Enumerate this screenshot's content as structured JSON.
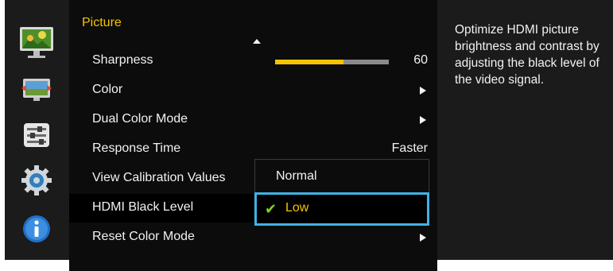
{
  "sidebar": {
    "icons": [
      "picture-monitor-icon",
      "screen-adjust-icon",
      "settings-sliders-icon",
      "gear-icon",
      "info-icon"
    ]
  },
  "menu": {
    "title": "Picture",
    "items": [
      {
        "label": "Sharpness",
        "value": "60",
        "slider_level": 0.6
      },
      {
        "label": "Color",
        "has_submenu": true
      },
      {
        "label": "Dual Color Mode",
        "has_submenu": true
      },
      {
        "label": "Response Time",
        "value": "Faster"
      },
      {
        "label": "View Calibration Values"
      },
      {
        "label": "HDMI Black Level",
        "selected": true
      },
      {
        "label": "Reset Color Mode",
        "has_submenu": true
      }
    ]
  },
  "popup": {
    "options": [
      "Normal",
      "Low"
    ],
    "selected": "Low"
  },
  "help": {
    "text": "Optimize HDMI picture brightness and contrast by adjusting the black level of the video signal."
  },
  "colors": {
    "accent": "#f5c400",
    "focus": "#3fb2e6",
    "check": "#7fd320",
    "panel": "#1b1b1b",
    "menu_bg": "#0c0c0c"
  }
}
